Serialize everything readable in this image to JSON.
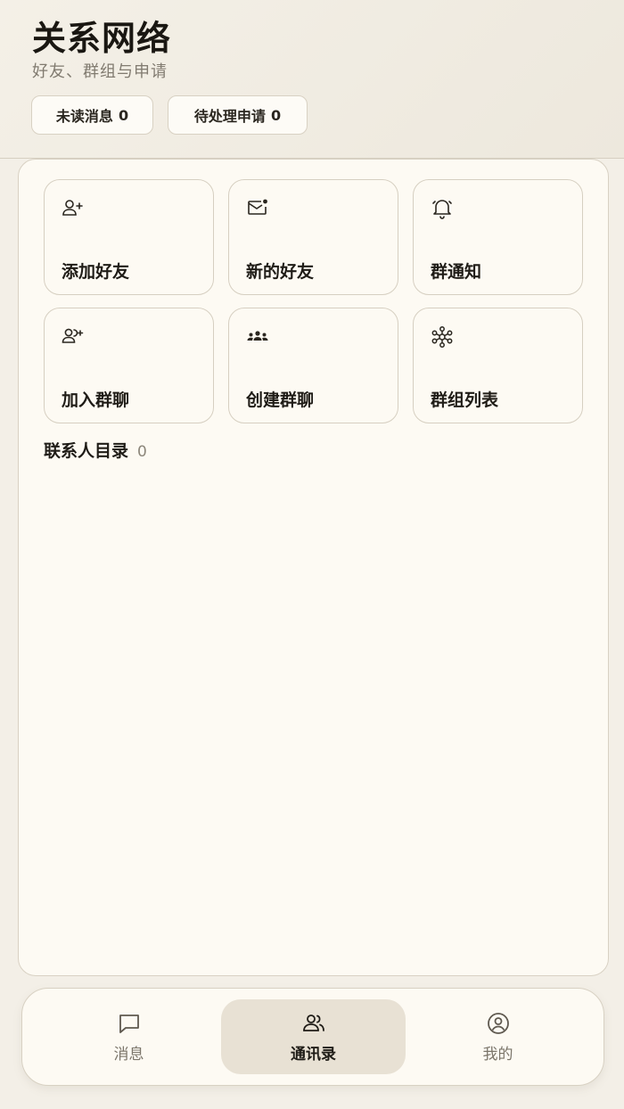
{
  "header": {
    "title": "关系网络",
    "subtitle": "好友、群组与申请",
    "chips": [
      {
        "label": "未读消息",
        "count": "0"
      },
      {
        "label": "待处理申请",
        "count": "0"
      }
    ]
  },
  "actions": [
    {
      "label": "添加好友",
      "icon": "user-plus-icon"
    },
    {
      "label": "新的好友",
      "icon": "mail-badge-icon"
    },
    {
      "label": "群通知",
      "icon": "bell-icon"
    },
    {
      "label": "加入群聊",
      "icon": "users-plus-icon"
    },
    {
      "label": "创建群聊",
      "icon": "group-icon"
    },
    {
      "label": "群组列表",
      "icon": "network-icon"
    }
  ],
  "contacts": {
    "title": "联系人目录",
    "count": "0"
  },
  "tabbar": {
    "items": [
      {
        "label": "消息",
        "icon": "chat-icon"
      },
      {
        "label": "通讯录",
        "icon": "contacts-icon"
      },
      {
        "label": "我的",
        "icon": "profile-icon"
      }
    ],
    "active": "通讯录"
  }
}
